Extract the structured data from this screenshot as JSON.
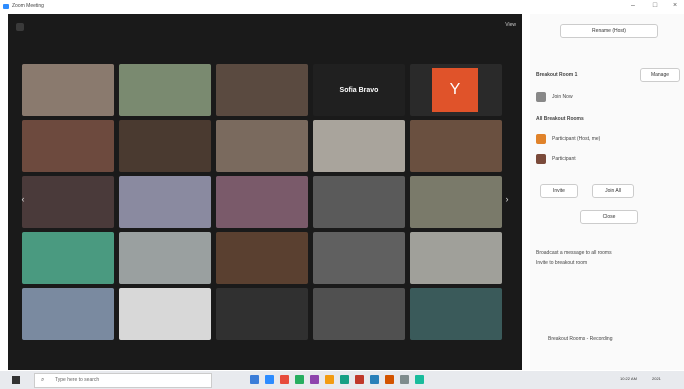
{
  "window": {
    "title": "Zoom Meeting"
  },
  "meeting": {
    "view_label": "View",
    "active_name": "Sofia Bravo",
    "tile_colors": [
      "#8a7a6e",
      "#7a8a70",
      "#5a4a40",
      "#202020",
      "#2a2a2a",
      "#6d4a3e",
      "#4a3a30",
      "#7a6a5e",
      "#a9a49c",
      "#6a5040",
      "#4a3a3a",
      "#8a8aa0",
      "#7a5a6a",
      "#5a5a5a",
      "#7a7a6a",
      "#4a9a80",
      "#9aa0a0",
      "#5a4030",
      "#606060",
      "#a0a09a",
      "#7a8aa0",
      "#d8d8d8",
      "#303030",
      "#505050",
      "#3a5a5a"
    ]
  },
  "panel": {
    "rename_label": "Rename (Host)",
    "manage_label": "Manage",
    "section_title": "Breakout Room 1",
    "host_name": "Join Now",
    "rooms_title": "All Breakout Rooms",
    "participant_1": "Participant (Host, me)",
    "participant_2": "Participant",
    "btn_a": "Invite",
    "btn_b": "Join All",
    "btn_c": "Close",
    "message_1": "Broadcast a message to all rooms",
    "message_2": "Invite to breakout room",
    "bottom_text": "Breakout Rooms - Recording"
  },
  "taskbar": {
    "search_placeholder": "Type here to search",
    "icon_colors": [
      "#3b7dd8",
      "#2d8cff",
      "#e74c3c",
      "#27ae60",
      "#8e44ad",
      "#f39c12",
      "#16a085",
      "#c0392b",
      "#2980b9",
      "#d35400",
      "#7f8c8d",
      "#1abc9c"
    ],
    "time": "10:22 AM",
    "date": "2021"
  }
}
